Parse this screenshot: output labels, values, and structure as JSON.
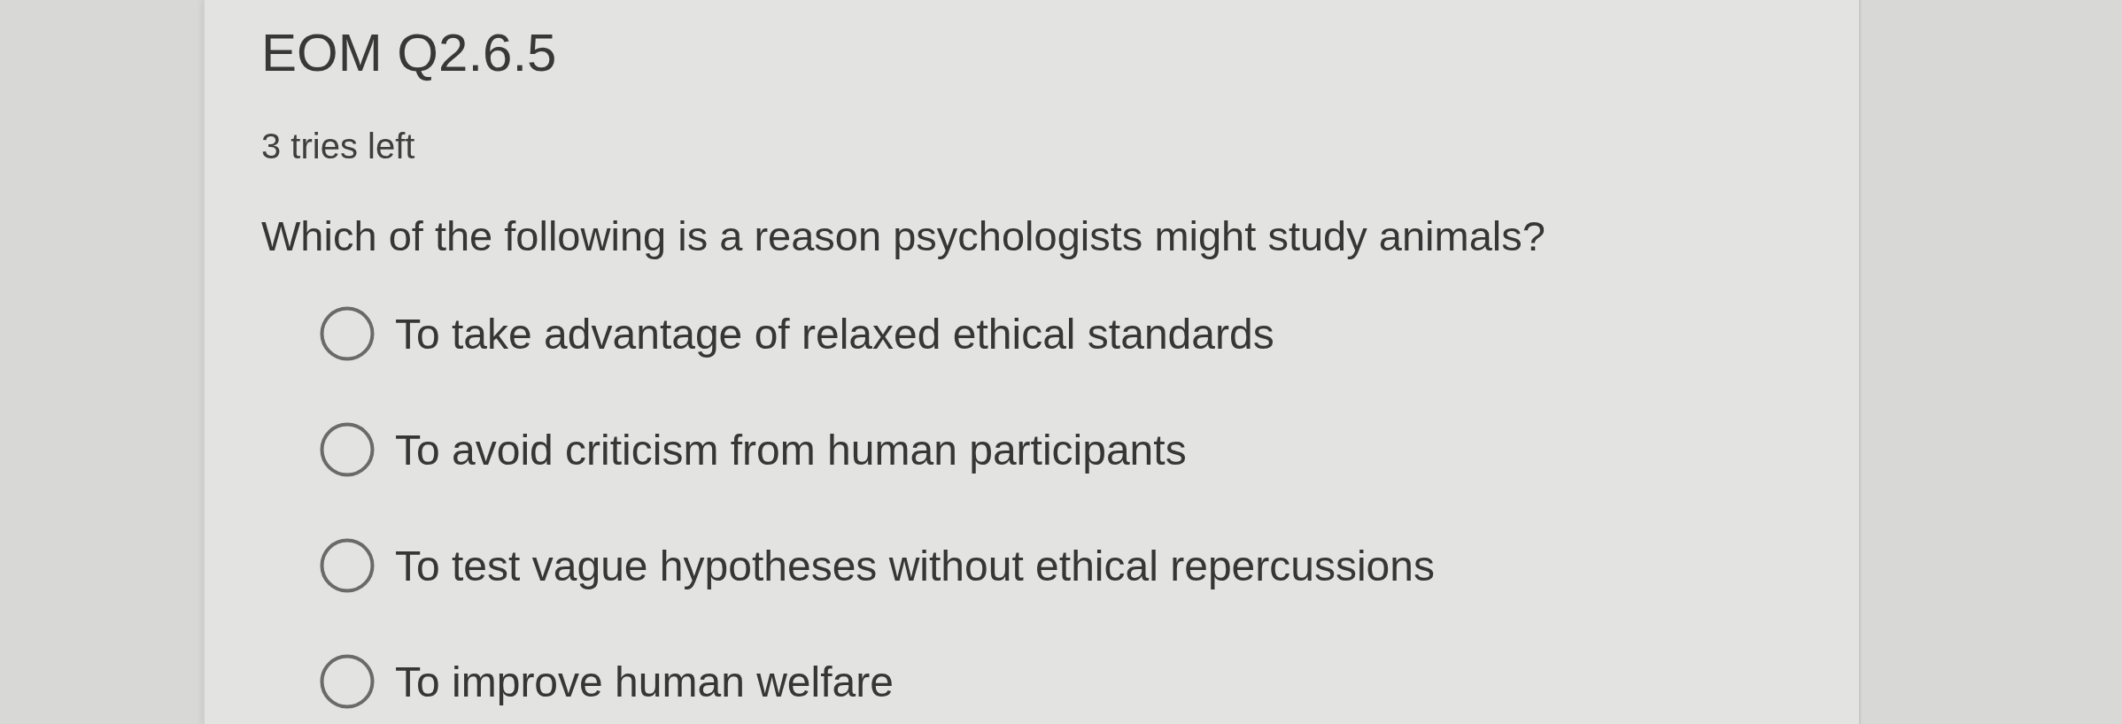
{
  "title": "EOM Q2.6.5",
  "attempts": "3 tries left",
  "question": "Which of the following is a reason psychologists might study animals?",
  "options": [
    {
      "label": "To take advantage of relaxed ethical standards",
      "selected": false
    },
    {
      "label": "To avoid criticism from human participants",
      "selected": false
    },
    {
      "label": "To test vague hypotheses without ethical repercussions",
      "selected": false
    },
    {
      "label": "To improve human welfare",
      "selected": false
    }
  ]
}
